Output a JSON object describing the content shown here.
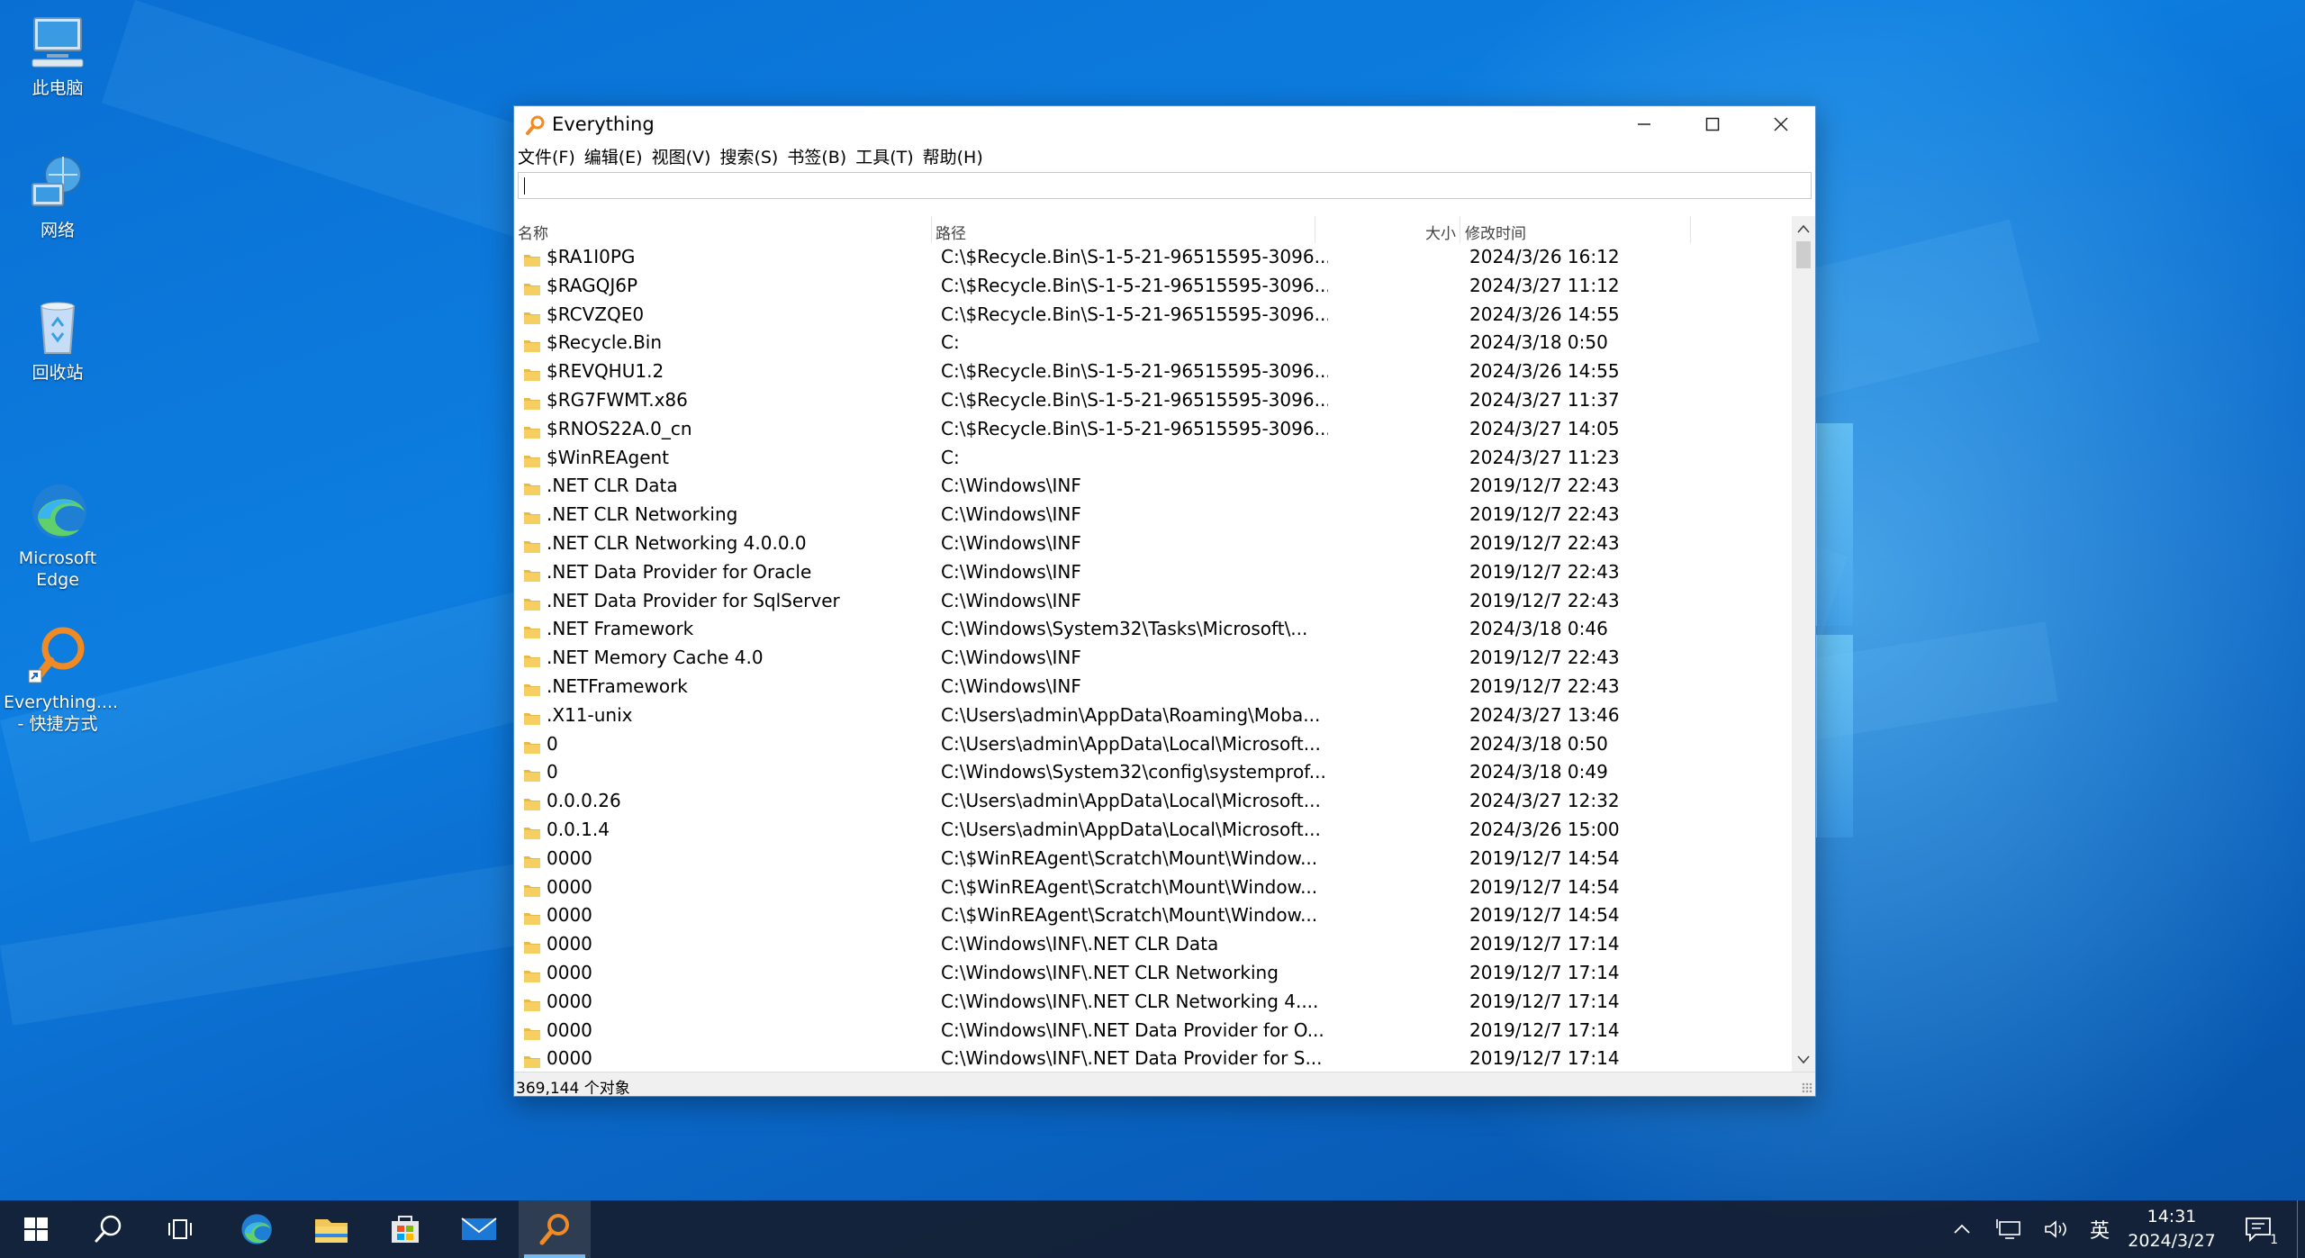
{
  "desktop": {
    "icons": [
      {
        "label": "此电脑"
      },
      {
        "label": "网络"
      },
      {
        "label": "回收站"
      },
      {
        "label": "Microsoft\nEdge"
      },
      {
        "label": "Everything....\n- 快捷方式"
      }
    ]
  },
  "window": {
    "title": "Everything",
    "menu": [
      "文件(F)",
      "编辑(E)",
      "视图(V)",
      "搜索(S)",
      "书签(B)",
      "工具(T)",
      "帮助(H)"
    ],
    "search": {
      "value": "",
      "placeholder": ""
    },
    "columns": {
      "name": "名称",
      "path": "路径",
      "size": "大小",
      "modified": "修改时间"
    },
    "rows": [
      {
        "name": "$RA1I0PG",
        "path": "C:\\$Recycle.Bin\\S-1-5-21-96515595-3096...",
        "modified": "2024/3/26 16:12"
      },
      {
        "name": "$RAGQJ6P",
        "path": "C:\\$Recycle.Bin\\S-1-5-21-96515595-3096...",
        "modified": "2024/3/27 11:12"
      },
      {
        "name": "$RCVZQE0",
        "path": "C:\\$Recycle.Bin\\S-1-5-21-96515595-3096...",
        "modified": "2024/3/26 14:55"
      },
      {
        "name": "$Recycle.Bin",
        "path": "C:",
        "modified": "2024/3/18 0:50"
      },
      {
        "name": "$REVQHU1.2",
        "path": "C:\\$Recycle.Bin\\S-1-5-21-96515595-3096...",
        "modified": "2024/3/26 14:55"
      },
      {
        "name": "$RG7FWMT.x86",
        "path": "C:\\$Recycle.Bin\\S-1-5-21-96515595-3096...",
        "modified": "2024/3/27 11:37"
      },
      {
        "name": "$RNOS22A.0_cn",
        "path": "C:\\$Recycle.Bin\\S-1-5-21-96515595-3096...",
        "modified": "2024/3/27 14:05"
      },
      {
        "name": "$WinREAgent",
        "path": "C:",
        "modified": "2024/3/27 11:23"
      },
      {
        "name": ".NET CLR Data",
        "path": "C:\\Windows\\INF",
        "modified": "2019/12/7 22:43"
      },
      {
        "name": ".NET CLR Networking",
        "path": "C:\\Windows\\INF",
        "modified": "2019/12/7 22:43"
      },
      {
        "name": ".NET CLR Networking 4.0.0.0",
        "path": "C:\\Windows\\INF",
        "modified": "2019/12/7 22:43"
      },
      {
        "name": ".NET Data Provider for Oracle",
        "path": "C:\\Windows\\INF",
        "modified": "2019/12/7 22:43"
      },
      {
        "name": ".NET Data Provider for SqlServer",
        "path": "C:\\Windows\\INF",
        "modified": "2019/12/7 22:43"
      },
      {
        "name": ".NET Framework",
        "path": "C:\\Windows\\System32\\Tasks\\Microsoft\\...",
        "modified": "2024/3/18 0:46"
      },
      {
        "name": ".NET Memory Cache 4.0",
        "path": "C:\\Windows\\INF",
        "modified": "2019/12/7 22:43"
      },
      {
        "name": ".NETFramework",
        "path": "C:\\Windows\\INF",
        "modified": "2019/12/7 22:43"
      },
      {
        "name": ".X11-unix",
        "path": "C:\\Users\\admin\\AppData\\Roaming\\Moba...",
        "modified": "2024/3/27 13:46"
      },
      {
        "name": "0",
        "path": "C:\\Users\\admin\\AppData\\Local\\Microsoft...",
        "modified": "2024/3/18 0:50"
      },
      {
        "name": "0",
        "path": "C:\\Windows\\System32\\config\\systemprof...",
        "modified": "2024/3/18 0:49"
      },
      {
        "name": "0.0.0.26",
        "path": "C:\\Users\\admin\\AppData\\Local\\Microsoft...",
        "modified": "2024/3/27 12:32"
      },
      {
        "name": "0.0.1.4",
        "path": "C:\\Users\\admin\\AppData\\Local\\Microsoft...",
        "modified": "2024/3/26 15:00"
      },
      {
        "name": "0000",
        "path": "C:\\$WinREAgent\\Scratch\\Mount\\Window...",
        "modified": "2019/12/7 14:54"
      },
      {
        "name": "0000",
        "path": "C:\\$WinREAgent\\Scratch\\Mount\\Window...",
        "modified": "2019/12/7 14:54"
      },
      {
        "name": "0000",
        "path": "C:\\$WinREAgent\\Scratch\\Mount\\Window...",
        "modified": "2019/12/7 14:54"
      },
      {
        "name": "0000",
        "path": "C:\\Windows\\INF\\.NET CLR Data",
        "modified": "2019/12/7 17:14"
      },
      {
        "name": "0000",
        "path": "C:\\Windows\\INF\\.NET CLR Networking",
        "modified": "2019/12/7 17:14"
      },
      {
        "name": "0000",
        "path": "C:\\Windows\\INF\\.NET CLR Networking 4....",
        "modified": "2019/12/7 17:14"
      },
      {
        "name": "0000",
        "path": "C:\\Windows\\INF\\.NET Data Provider for O...",
        "modified": "2019/12/7 17:14"
      },
      {
        "name": "0000",
        "path": "C:\\Windows\\INF\\.NET Data Provider for S...",
        "modified": "2019/12/7 17:14"
      }
    ],
    "status": "369,144 个对象"
  },
  "taskbar": {
    "ime": "英",
    "time": "14:31",
    "date": "2024/3/27",
    "notification_count": "1"
  },
  "colors": {
    "accent": "#76b9ed",
    "folder": "#f3c65a",
    "everything_orange": "#f08a24"
  }
}
